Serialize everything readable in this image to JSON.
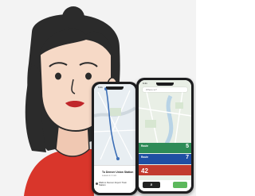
{
  "colors": {
    "background": "#f3f3f3",
    "hair": "#2b2b2b",
    "skin": "#f6d9c6",
    "shirt": "#d9362b",
    "lips": "#c0262a",
    "route_green": "#2e8b57",
    "route_blue": "#1f4fa3",
    "route_red": "#c23b2f",
    "accent_green": "#5cb85c"
  },
  "left_phone": {
    "time": "9:41",
    "destination": "To Denver Union Station",
    "subtitle": "Leaves in 4 min",
    "walk_text": "Walk to Denver Airport Train Station"
  },
  "right_phone": {
    "time": "9:41",
    "search_placeholder": "Where to?",
    "cards": [
      {
        "route": "Route",
        "value": "5",
        "color": "#2e8b57"
      },
      {
        "route": "Route",
        "value": "7",
        "color": "#1f4fa3"
      },
      {
        "route": "Route",
        "value": "42",
        "color": "#c23b2f"
      }
    ],
    "bottom_left": "Ƨ",
    "bottom_right": ""
  },
  "icons": [
    "woman-avatar-illustration",
    "location-pin-icon",
    "walk-icon",
    "search-icon"
  ]
}
